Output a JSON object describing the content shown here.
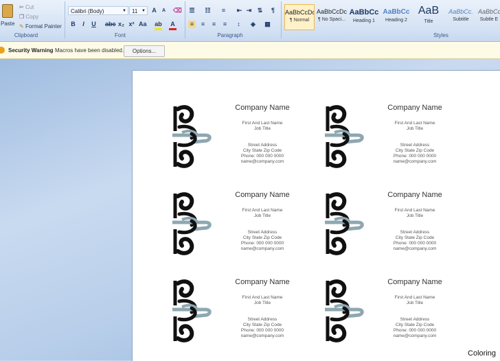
{
  "ribbon": {
    "clipboard": {
      "paste_label": "Paste",
      "cut_label": "Cut",
      "copy_label": "Copy",
      "format_painter_label": "Format Painter",
      "group_label": "Clipboard"
    },
    "font": {
      "font_name": "Calibri (Body)",
      "font_size": "11",
      "group_label": "Font"
    },
    "paragraph": {
      "group_label": "Paragraph"
    },
    "styles": {
      "group_label": "Styles",
      "items": [
        {
          "sample": "AaBbCcDc",
          "name": "¶ Normal"
        },
        {
          "sample": "AaBbCcDc",
          "name": "¶ No Spaci..."
        },
        {
          "sample": "AaBbCс",
          "name": "Heading 1"
        },
        {
          "sample": "AaBbCc",
          "name": "Heading 2"
        },
        {
          "sample": "AaB",
          "name": "Title"
        },
        {
          "sample": "AaBbCc.",
          "name": "Subtitle"
        },
        {
          "sample": "AaBbCcL",
          "name": "Subtle E"
        }
      ]
    }
  },
  "message_bar": {
    "label": "Security Warning",
    "text": "Macros have been disabled.",
    "options_label": "Options..."
  },
  "card": {
    "company": "Company Name",
    "name_line": "First And Last Name",
    "job_title": "Job Title",
    "street": "Street Address",
    "city": "City State Zip Code",
    "phone": "Phone: 000 000 0000",
    "email": "name@company.com"
  },
  "watermark": "Coloring",
  "colors": {
    "ornament_dark": "#111111",
    "ornament_accent": "#8ea7b0",
    "highlight": "#f0b849"
  }
}
